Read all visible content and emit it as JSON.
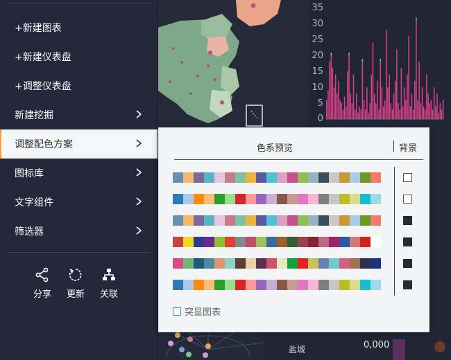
{
  "menu": {
    "items": [
      {
        "label": "+新建图表",
        "chevron": false
      },
      {
        "label": "+新建仪表盘",
        "chevron": false
      },
      {
        "label": "+调整仪表盘",
        "chevron": false
      },
      {
        "label": "新建挖掘",
        "chevron": true
      },
      {
        "label": "调整配色方案",
        "chevron": true,
        "active": true
      },
      {
        "label": "图标库",
        "chevron": true
      },
      {
        "label": "文字组件",
        "chevron": true
      },
      {
        "label": "筛选器",
        "chevron": true
      }
    ],
    "tools": [
      {
        "label": "分享",
        "icon": "share-icon"
      },
      {
        "label": "更新",
        "icon": "refresh-icon"
      },
      {
        "label": "关联",
        "icon": "hierarchy-icon"
      }
    ]
  },
  "popup": {
    "header_preview": "色系预览",
    "header_background": "背景",
    "highlight_label": "突显图表",
    "palettes": [
      {
        "colors": [
          "#6b8fb0",
          "#f5b86a",
          "#7a6a9a",
          "#56b5c4",
          "#e7c4e0",
          "#c77a8a",
          "#79c5a3",
          "#f0b33a",
          "#5a5aa0",
          "#4cc2d8",
          "#d9a0c0",
          "#c85090",
          "#8cc050",
          "#97b3c0",
          "#3f4b5a",
          "#c8c8c8",
          "#c89a30",
          "#a8cce8",
          "#6a9a20",
          "#f57a6a"
        ],
        "background": "light"
      },
      {
        "colors": [
          "#2f7ab8",
          "#aac8e8",
          "#ff8a10",
          "#ffbb78",
          "#2ca02c",
          "#98df8a",
          "#d62728",
          "#ff9896",
          "#9467bd",
          "#c5b0d5",
          "#8c564b",
          "#c49c94",
          "#e377c2",
          "#f7b6d2",
          "#7f7f7f",
          "#c7c7c7",
          "#bcbd22",
          "#dbdb8d",
          "#17becf",
          "#9edae5"
        ],
        "background": "light"
      },
      {
        "colors": [
          "#6b8fb0",
          "#f5b86a",
          "#7a6a9a",
          "#56b5c4",
          "#e7c4e0",
          "#c77a8a",
          "#79c5a3",
          "#f0b33a",
          "#5a5aa0",
          "#4cc2d8",
          "#d9a0c0",
          "#c85090",
          "#8cc050",
          "#97b3c0",
          "#3f4b5a",
          "#c8c8c8",
          "#c89a30",
          "#a8cce8",
          "#6a9a20",
          "#f57a6a"
        ],
        "background": "dark"
      },
      {
        "colors": [
          "#c8443a",
          "#f0d820",
          "#2e3a8a",
          "#6a2a8a",
          "#90c030",
          "#e04030",
          "#808890",
          "#c05060",
          "#a0c060",
          "#3a6aa0",
          "#9a6030",
          "#306030",
          "#9a4050",
          "#8a2030",
          "#b86a80",
          "#a0206a",
          "#2a5aa0",
          "#d07a70",
          "#d02020",
          "#ffffff"
        ],
        "background": "dark"
      },
      {
        "colors": [
          "#d84a8a",
          "#70b870",
          "#1e5a7a",
          "#4a8a9a",
          "#d89878",
          "#90d0c0",
          "#5a4030",
          "#e8d0a0",
          "#5a3050",
          "#d05070",
          "#e8e8c0",
          "#10a040",
          "#e82020",
          "#c8c060",
          "#6a80b0",
          "#70c8c8",
          "#d06080",
          "#a07050",
          "#2a3050",
          "#203080"
        ],
        "background": "dark"
      },
      {
        "colors": [
          "#2f7ab8",
          "#aac8e8",
          "#ff8a10",
          "#ffbb78",
          "#2ca02c",
          "#98df8a",
          "#d62728",
          "#ff9896",
          "#9467bd",
          "#c5b0d5",
          "#8c564b",
          "#c49c94",
          "#e377c2",
          "#f7b6d2",
          "#7f7f7f",
          "#c7c7c7",
          "#bcbd22",
          "#dbdb8d",
          "#17becf",
          "#9edae5"
        ],
        "background": "dark"
      }
    ]
  },
  "background": {
    "yticks": [
      "35",
      "30",
      "25",
      "20",
      "15",
      "10",
      "5",
      "0"
    ],
    "bar_values": [
      6,
      9,
      18,
      20,
      16,
      10,
      14,
      8,
      12,
      6,
      5,
      3,
      7,
      4,
      15,
      20,
      8,
      5,
      14,
      3,
      8,
      2,
      4,
      3,
      18,
      6,
      3,
      10,
      2,
      5,
      14,
      24,
      8,
      5,
      12,
      3,
      18,
      10,
      4,
      6,
      28,
      10,
      14,
      5,
      3,
      8,
      12,
      22,
      5,
      3,
      16,
      4,
      10,
      6,
      14,
      26,
      4,
      8,
      3,
      12,
      31,
      6,
      18,
      5,
      10,
      4,
      3,
      14,
      8,
      5,
      6,
      3,
      10,
      4,
      8,
      2,
      5,
      3,
      6
    ],
    "city_label": "盐城",
    "value_label": "0,000"
  }
}
